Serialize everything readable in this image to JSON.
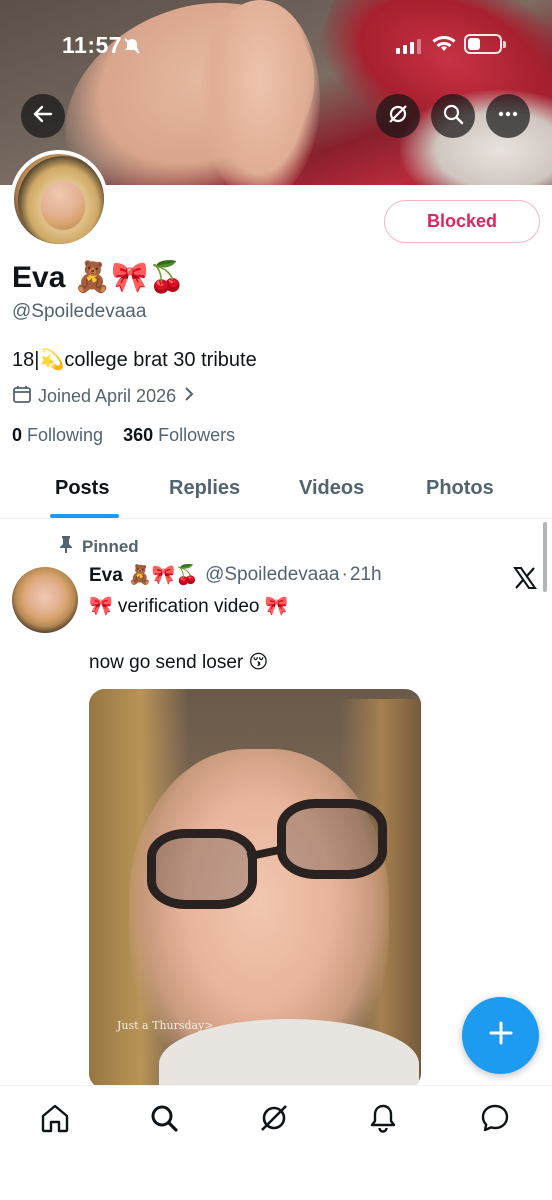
{
  "status_bar": {
    "time": "11:57"
  },
  "profile": {
    "display_name": "Eva 🧸🎀🍒",
    "handle": "@Spoiledevaaa",
    "bio": "18|💫college brat 30 tribute",
    "joined": "Joined April 2026",
    "following_count": "0",
    "following_label": "Following",
    "followers_count": "360",
    "followers_label": "Followers",
    "blocked_label": "Blocked"
  },
  "tabs": [
    {
      "label": "Posts",
      "active": true
    },
    {
      "label": "Replies",
      "active": false
    },
    {
      "label": "Videos",
      "active": false
    },
    {
      "label": "Photos",
      "active": false
    }
  ],
  "post": {
    "pinned_label": "Pinned",
    "author_name": "Eva 🧸🎀🍒",
    "author_handle": "@Spoiledevaaa",
    "separator": "·",
    "time": "21h",
    "text_line1": "🎀 verification video 🎀",
    "text_line2": "now go send loser 😚",
    "media_caption": "Just a Thursday>"
  },
  "colors": {
    "accent": "#1d9bf0",
    "blocked": "#e0245e",
    "muted": "#536471"
  },
  "icons": {
    "top_bar": [
      "back-arrow-icon",
      "grok-icon",
      "search-icon",
      "more-icon"
    ],
    "bottom_nav": [
      "home-icon",
      "search-icon",
      "grok-icon",
      "notifications-icon",
      "messages-icon"
    ]
  }
}
